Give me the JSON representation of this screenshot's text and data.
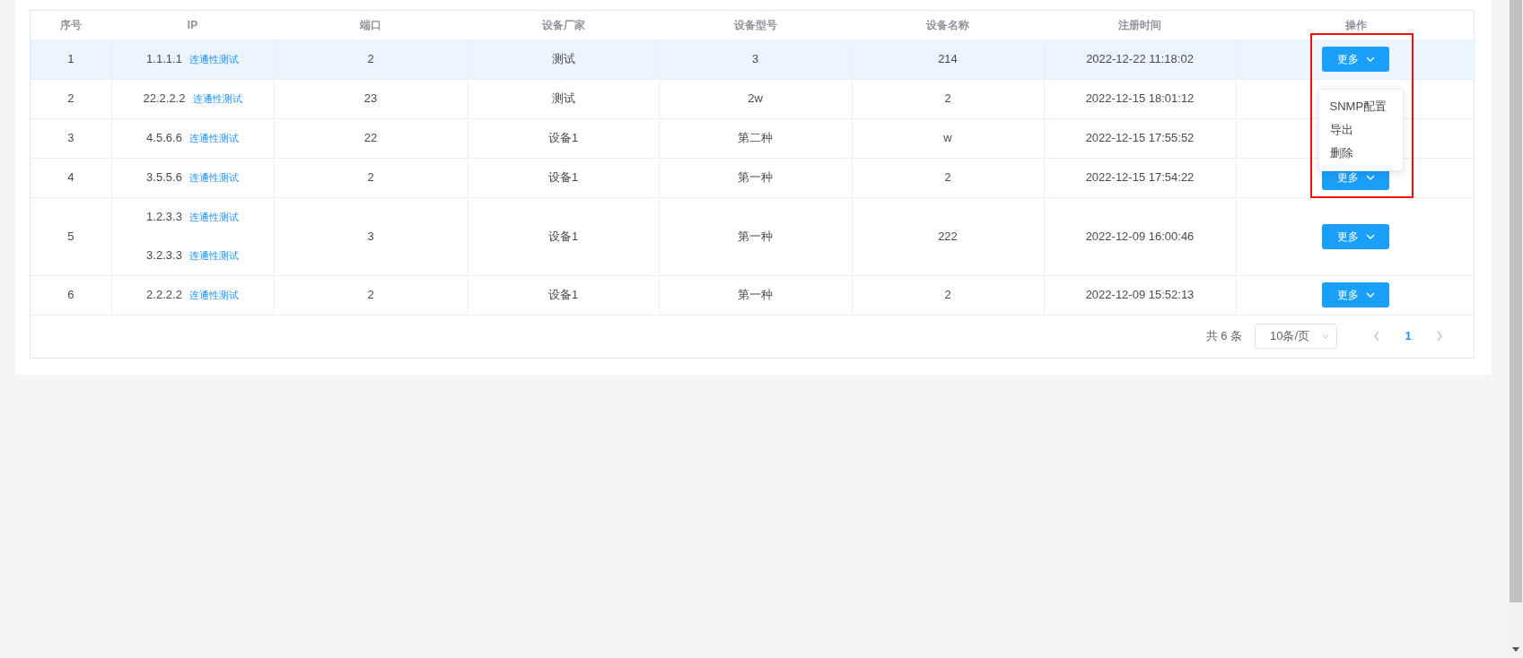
{
  "columns": [
    "序号",
    "IP",
    "端口",
    "设备厂家",
    "设备型号",
    "设备名称",
    "注册时间",
    "操作"
  ],
  "rows": [
    {
      "index": "1",
      "ips": [
        {
          "address": "1.1.1.1",
          "link": "连通性测试"
        }
      ],
      "port": "2",
      "vendor": "测试",
      "model": "3",
      "device_name": "214",
      "registered": "2022-12-22 11:18:02",
      "action": "更多",
      "selected": true
    },
    {
      "index": "2",
      "ips": [
        {
          "address": "22.2.2.2",
          "link": "连通性测试"
        }
      ],
      "port": "23",
      "vendor": "测试",
      "model": "2w",
      "device_name": "2",
      "registered": "2022-12-15 18:01:12",
      "selected": false
    },
    {
      "index": "3",
      "ips": [
        {
          "address": "4.5.6.6",
          "link": "连通性测试"
        }
      ],
      "port": "22",
      "vendor": "设备1",
      "model": "第二种",
      "device_name": "w",
      "registered": "2022-12-15 17:55:52",
      "selected": false
    },
    {
      "index": "4",
      "ips": [
        {
          "address": "3.5.5.6",
          "link": "连通性测试"
        }
      ],
      "port": "2",
      "vendor": "设备1",
      "model": "第一种",
      "device_name": "2",
      "registered": "2022-12-15 17:54:22",
      "action": "更多",
      "selected": false
    },
    {
      "index": "5",
      "ips": [
        {
          "address": "1.2.3.3",
          "link": "连通性测试"
        },
        {
          "address": "3.2.3.3",
          "link": "连通性测试"
        }
      ],
      "port": "3",
      "vendor": "设备1",
      "model": "第一种",
      "device_name": "222",
      "registered": "2022-12-09 16:00:46",
      "action": "更多",
      "selected": false
    },
    {
      "index": "6",
      "ips": [
        {
          "address": "2.2.2.2",
          "link": "连通性测试"
        }
      ],
      "port": "2",
      "vendor": "设备1",
      "model": "第一种",
      "device_name": "2",
      "registered": "2022-12-09 15:52:13",
      "action": "更多",
      "selected": false
    }
  ],
  "action_menu": {
    "items": [
      "SNMP配置",
      "导出",
      "删除"
    ]
  },
  "pagination": {
    "total": "共 6 条",
    "page_size": "10条/页",
    "pages": [
      {
        "label": "1",
        "selected": true
      }
    ]
  }
}
